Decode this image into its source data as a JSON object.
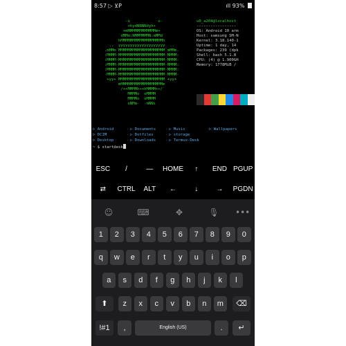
{
  "status_bar": {
    "time": "8:57",
    "notif_icons": "▷ ⊻P",
    "signal": "ıll",
    "battery": "93%"
  },
  "terminal": {
    "art_lines": [
      "              -o            o-",
      "               +hydNNNNdyh+",
      "             +mMMMMMMMMMMMMm+",
      "           `dMMm:NMMMMMMN:mMMd`",
      "           hMMMMMMMMMMMMMMMMMMh",
      "       ..  yyyyyyyyyyyyyyyyyyyy  ..",
      "     .mMMm`MMMMMMMMMMMMMMMMMMMM`mMMm.",
      "     :MMMM-MMMMMMMMMMMMMMMMMMMM-MMMM:",
      "     :MMMM-MMMMMMMMMMMMMMMMMMMM-MMMM:",
      "     :MMMM-MMMMMMMMMMMMMMMMMMMM-MMMM:",
      "     :MMMM-MMMMMMMMMMMMMMMMMMMM-MMMM:",
      "     -MMMM-MMMMMMMMMMMMMMMMMMMM-MMMM-",
      "      +yy+ MMMMMMMMMMMMMMMMMMMM +yy+",
      "           mMMMMMMMMMMMMMMMMMMm",
      "           `/++MMMMh++hMMMM++/`",
      "               MMMMo  oMMMM",
      "               MMMMo  oMMMM",
      "               oNMm-  -mNNs"
    ],
    "sysinfo": [
      {
        "text": "u0_a204@localhost",
        "highlight": true
      },
      {
        "text": "-----------------",
        "highlight": false
      },
      {
        "text": "OS: Android 10 arm",
        "highlight": false
      },
      {
        "text": "Host: samsung SM-N",
        "highlight": false
      },
      {
        "text": "Kernel: 3.18.140-1",
        "highlight": false
      },
      {
        "text": "Uptime: 1 day, 14",
        "highlight": false
      },
      {
        "text": "Packages: 239 (dpk",
        "highlight": false
      },
      {
        "text": "Shell: bash 5.1.8",
        "highlight": false
      },
      {
        "text": "CPU: (4) @ 1.900GH",
        "highlight": false
      },
      {
        "text": "Memory: 1778MiB /",
        "highlight": false
      }
    ],
    "palette": [
      "#2a2a2a",
      "#e53935",
      "#43a047",
      "#fdd835",
      "#1e88e5",
      "#d81b60",
      "#00acc1",
      "#eeeeee"
    ],
    "dirs": [
      [
        "Android",
        "Documents",
        "Music",
        "Wallpapers"
      ],
      [
        "DCIM",
        "Dotfiles",
        "storage",
        ""
      ],
      [
        "Desktop",
        "Downloads",
        "Termux-Desk",
        ""
      ]
    ],
    "prompt": "~ $ startdesk"
  },
  "extra_keys": {
    "row1": [
      "ESC",
      "/",
      "—",
      "HOME",
      "↑",
      "END",
      "PGUP"
    ],
    "row2": [
      "⇄",
      "CTRL",
      "ALT",
      "←",
      "↓",
      "→",
      "PGDN"
    ]
  },
  "keyboard": {
    "toolbar_icons": [
      "emoji-icon",
      "keyboard-icon",
      "cursor-move-icon",
      "mic-icon",
      "more-icon"
    ],
    "toolbar_glyphs": [
      "☺",
      "⌨",
      "✥",
      "🎙",
      "•••"
    ],
    "numbers": [
      "1",
      "2",
      "3",
      "4",
      "5",
      "6",
      "7",
      "8",
      "9",
      "0"
    ],
    "row1": [
      "q",
      "w",
      "e",
      "r",
      "t",
      "y",
      "u",
      "i",
      "o",
      "p"
    ],
    "row2": [
      "a",
      "s",
      "d",
      "f",
      "g",
      "h",
      "j",
      "k",
      "l"
    ],
    "row3": [
      "z",
      "x",
      "c",
      "v",
      "b",
      "n",
      "m"
    ],
    "shift": "⬆",
    "backspace": "⌫",
    "symbols": "!#1",
    "comma": ",",
    "space": "English (US)",
    "period": ".",
    "enter": "↵"
  }
}
